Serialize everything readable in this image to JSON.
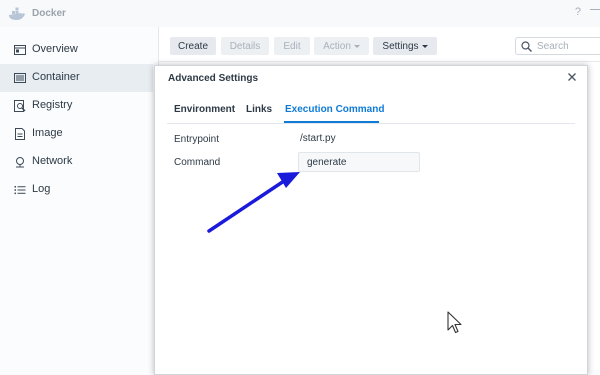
{
  "app": {
    "title": "Docker"
  },
  "titlebar": {
    "help_label": "?"
  },
  "sidebar": {
    "items": [
      {
        "label": "Overview",
        "icon": "overview-icon"
      },
      {
        "label": "Container",
        "icon": "container-icon",
        "active": true
      },
      {
        "label": "Registry",
        "icon": "registry-icon"
      },
      {
        "label": "Image",
        "icon": "image-icon"
      },
      {
        "label": "Network",
        "icon": "network-icon"
      },
      {
        "label": "Log",
        "icon": "log-icon"
      }
    ]
  },
  "toolbar": {
    "create_label": "Create",
    "details_label": "Details",
    "edit_label": "Edit",
    "action_label": "Action",
    "settings_label": "Settings",
    "search_placeholder": "Search"
  },
  "dialog": {
    "title": "Advanced Settings",
    "tabs": [
      {
        "label": "Environment"
      },
      {
        "label": "Links"
      },
      {
        "label": "Execution Command",
        "active": true
      }
    ],
    "fields": {
      "entrypoint_label": "Entrypoint",
      "entrypoint_value": "/start.py",
      "command_label": "Command",
      "command_value": "generate"
    }
  },
  "annotation": {
    "arrow_color": "#1a1adb"
  },
  "colors": {
    "accent": "#0f7bd6",
    "active_nav_bg": "#e8edf2"
  }
}
